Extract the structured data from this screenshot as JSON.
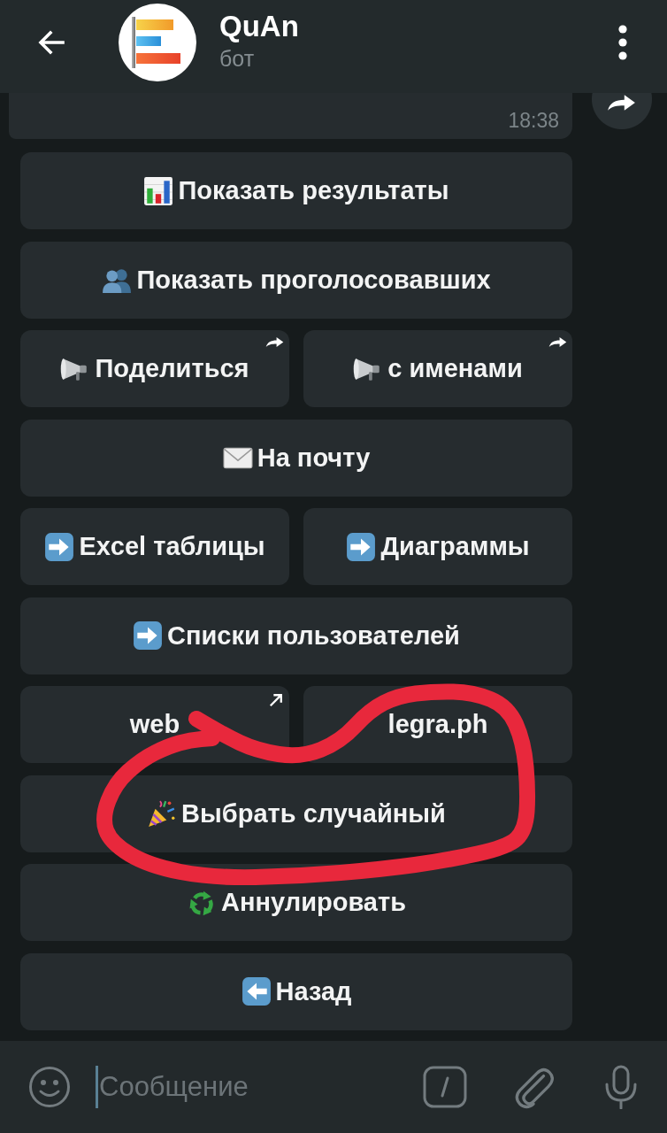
{
  "header": {
    "title": "QuAn",
    "subtitle": "бот"
  },
  "message": {
    "time": "18:38"
  },
  "keyboard": {
    "rows": [
      [
        {
          "label": "Показать результаты",
          "kind": "chart",
          "share": false,
          "external": false
        }
      ],
      [
        {
          "label": "Показать проголосовавших",
          "kind": "people",
          "share": false,
          "external": false
        }
      ],
      [
        {
          "label": "Поделиться",
          "kind": "megaphone",
          "share": true,
          "external": false
        },
        {
          "label": "с именами",
          "kind": "megaphone",
          "share": true,
          "external": false
        }
      ],
      [
        {
          "label": "На почту",
          "kind": "envelope",
          "share": false,
          "external": false
        }
      ],
      [
        {
          "label": "Excel таблицы",
          "kind": "arrow",
          "share": false,
          "external": false
        },
        {
          "label": "Диаграммы",
          "kind": "arrow",
          "share": false,
          "external": false
        }
      ],
      [
        {
          "label": "Списки пользователей",
          "kind": "arrow",
          "share": false,
          "external": false
        }
      ],
      [
        {
          "label": "web",
          "share": false,
          "external": true
        },
        {
          "label": "legra.ph",
          "share": false,
          "external": false
        }
      ],
      [
        {
          "label": "Выбрать случайный",
          "kind": "party",
          "share": false,
          "external": false
        }
      ],
      [
        {
          "label": "Аннулировать",
          "kind": "recycle",
          "share": false,
          "external": false
        }
      ],
      [
        {
          "label": "Назад",
          "kind": "back",
          "share": false,
          "external": false
        }
      ]
    ]
  },
  "input": {
    "placeholder": "Сообщение"
  },
  "annotation": {
    "kind": "loop"
  }
}
